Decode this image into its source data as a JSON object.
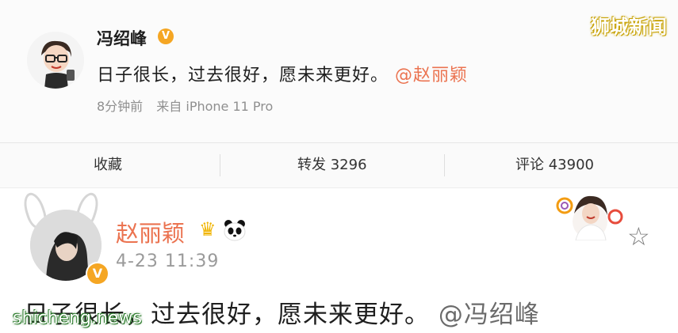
{
  "post1": {
    "author": "冯绍峰",
    "badge": "V",
    "text": "日子很长，过去很好，愿未来更好。",
    "mention": "@赵丽颖",
    "time": "8分钟前",
    "source": "来自 iPhone 11 Pro"
  },
  "actions": {
    "collect": "收藏",
    "repost": "转发 3296",
    "comment": "评论 43900"
  },
  "post2": {
    "author": "赵丽颖",
    "badge": "V",
    "time": "4-23 11:39",
    "text": "日子很长，过去很好，愿未来更好。",
    "mention": "@冯绍峰"
  },
  "watermarks": {
    "top": "狮城新闻",
    "bottom": "shicheng.news"
  },
  "colors": {
    "accent": "#eb7350",
    "badge": "#f5a623"
  }
}
